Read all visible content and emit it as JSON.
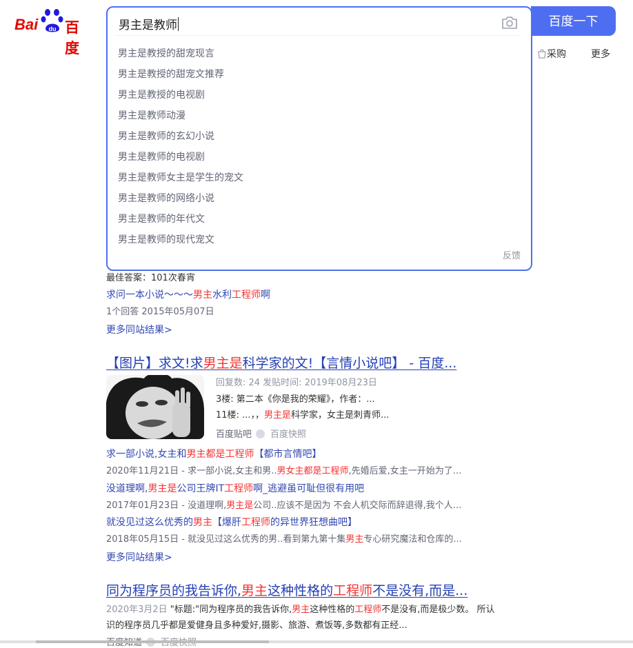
{
  "logo": {
    "part1": "Bai",
    "part2": "百度"
  },
  "search": {
    "query": "男主是教师",
    "button_label": "百度一下"
  },
  "suggestions": [
    "男主是教授的甜宠现言",
    "男主是教授的甜宠文推荐",
    "男主是教授的电视剧",
    "男主是教师动漫",
    "男主是教师的玄幻小说",
    "男主是教师的电视剧",
    "男主是教师女主是学生的宠文",
    "男主是教师的网络小说",
    "男主是教师的年代文",
    "男主是教师的现代宠文"
  ],
  "feedback_label": "反馈",
  "tabs_right": {
    "purchase": "采购",
    "more": "更多"
  },
  "results": {
    "best_answer": "最佳答案：101次春宵",
    "q1_prefix": "求问一本小说～～～",
    "q1_hl1": "男主",
    "q1_mid": "水利",
    "q1_hl2": "工程师",
    "q1_suffix": "啊",
    "q1_meta": "1个回答   2015年05月07日",
    "more_site_1": "更多同站结果>",
    "t2_prefix": "【图片】求文!求",
    "t2_hl": "男主是",
    "t2_suffix": "科学家的文!【言情小说吧】 - 百度...",
    "t2_line1": "回复数: 24 发贴时间: 2019年08月23日",
    "t2_line2": "3楼: 第二本《你是我的荣耀》，作者：...",
    "t2_line3_prefix": "11楼: ...，，",
    "t2_line3_hl": "男主是",
    "t2_line3_suffix": "科学家，女主是刺青师...",
    "t2_source": "百度贴吧",
    "t2_snapshot": "百度快照",
    "s1_prefix": "求一部小说,女主和",
    "s1_hl1": "男主都是工程师",
    "s1_suffix": "【都市言情吧】",
    "s1_meta_prefix": "2020年11月21日 - 求一部小说,女主和男..",
    "s1_meta_hl": "男女主都是工程师",
    "s1_meta_suffix": ",先婚后爱,女主一开始为了...",
    "s2_prefix": "没道理啊,",
    "s2_hl1": "男主是",
    "s2_mid": "公司王牌IT",
    "s2_hl2": "工程师",
    "s2_suffix": "啊_逃避虽可耻但很有用吧",
    "s2_meta_prefix": "2017年01月23日 - 没道理啊,",
    "s2_meta_hl": "男主是",
    "s2_meta_suffix": "公司..应该不是因为 不会人机交际而辞退得,我个人...",
    "s3_prefix": "就没见过这么优秀的",
    "s3_hl1": "男主",
    "s3_mid": "【爆肝",
    "s3_hl2": "工程师",
    "s3_suffix": "的异世界狂想曲吧】",
    "s3_meta_prefix": "2018年05月15日 - 就没见过这么优秀的男..看到第九第十集",
    "s3_meta_hl": "男主",
    "s3_meta_suffix": "专心研究魔法和仓库的...",
    "more_site_2": "更多同站结果>",
    "t3_prefix": "同为程序员的我告诉你,",
    "t3_hl1": "男主",
    "t3_mid": "这种性格的",
    "t3_hl2": "工程师",
    "t3_suffix": "不是没有,而是...",
    "t3_date": "2020年3月2日",
    "t3_l1_prefix": " \"标题:\"同为程序员的我告诉你,",
    "t3_l1_hl1": "男主",
    "t3_l1_mid": "这种性格的",
    "t3_l1_hl2": "工程师",
    "t3_l1_suffix": "不是没有,而是极少数。 所认",
    "t3_l2": "识的程序员几乎都是爱健身且多种爱好,摄影、旅游、煮饭等,多数都有正经...",
    "t3_source": "百度知道",
    "t3_snapshot": "百度快照"
  },
  "colors": {
    "accent": "#4e6ef2",
    "highlight": "#f73131",
    "link": "#3248b0"
  }
}
